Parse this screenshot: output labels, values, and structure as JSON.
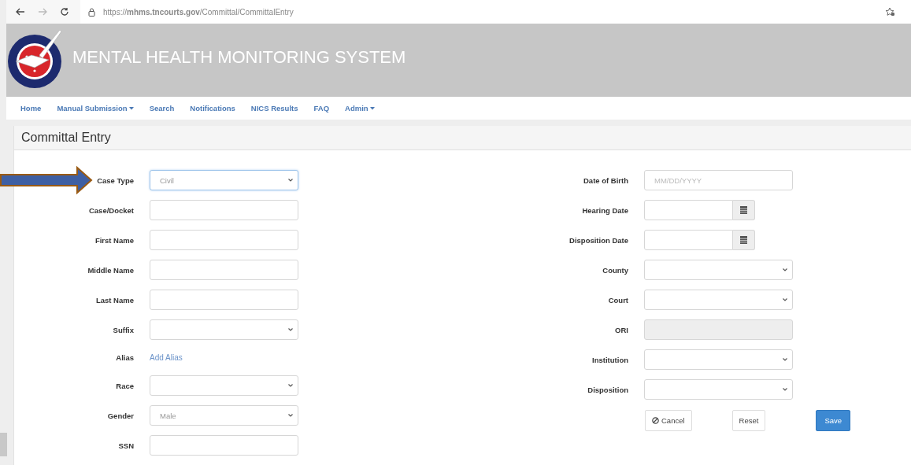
{
  "browser": {
    "url": "https://**mhms.tncourts.gov**/Committal/CommittalEntry"
  },
  "header": {
    "title": "MENTAL HEALTH MONITORING SYSTEM"
  },
  "nav": [
    {
      "label": "Home",
      "dropdown": false
    },
    {
      "label": "Manual Submission",
      "dropdown": true
    },
    {
      "label": "Search",
      "dropdown": false
    },
    {
      "label": "Notifications",
      "dropdown": false
    },
    {
      "label": "NICS Results",
      "dropdown": false
    },
    {
      "label": "FAQ",
      "dropdown": false
    },
    {
      "label": "Admin",
      "dropdown": true
    }
  ],
  "panel": {
    "title": "Committal Entry"
  },
  "left_fields": [
    {
      "label": "Case Type",
      "kind": "select",
      "value": "Civil",
      "focused": true
    },
    {
      "label": "Case/Docket",
      "kind": "text"
    },
    {
      "label": "First Name",
      "kind": "text"
    },
    {
      "label": "Middle Name",
      "kind": "text"
    },
    {
      "label": "Last Name",
      "kind": "text"
    },
    {
      "label": "Suffix",
      "kind": "select"
    },
    {
      "label": "Alias",
      "kind": "link",
      "value": "Add Alias"
    },
    {
      "label": "Race",
      "kind": "select"
    },
    {
      "label": "Gender",
      "kind": "select",
      "value": "Male"
    },
    {
      "label": "SSN",
      "kind": "text"
    }
  ],
  "right_fields": [
    {
      "label": "Date of Birth",
      "kind": "text",
      "placeholder": "MM/DD/YYYY"
    },
    {
      "label": "Hearing Date",
      "kind": "date"
    },
    {
      "label": "Disposition Date",
      "kind": "date"
    },
    {
      "label": "County",
      "kind": "select"
    },
    {
      "label": "Court",
      "kind": "select"
    },
    {
      "label": "ORI",
      "kind": "readonly"
    },
    {
      "label": "Institution",
      "kind": "select"
    },
    {
      "label": "Disposition",
      "kind": "select"
    }
  ],
  "buttons": [
    {
      "label": "Cancel",
      "kind": "cancel"
    },
    {
      "label": "Reset",
      "kind": "default"
    },
    {
      "label": "Save",
      "kind": "primary"
    }
  ]
}
